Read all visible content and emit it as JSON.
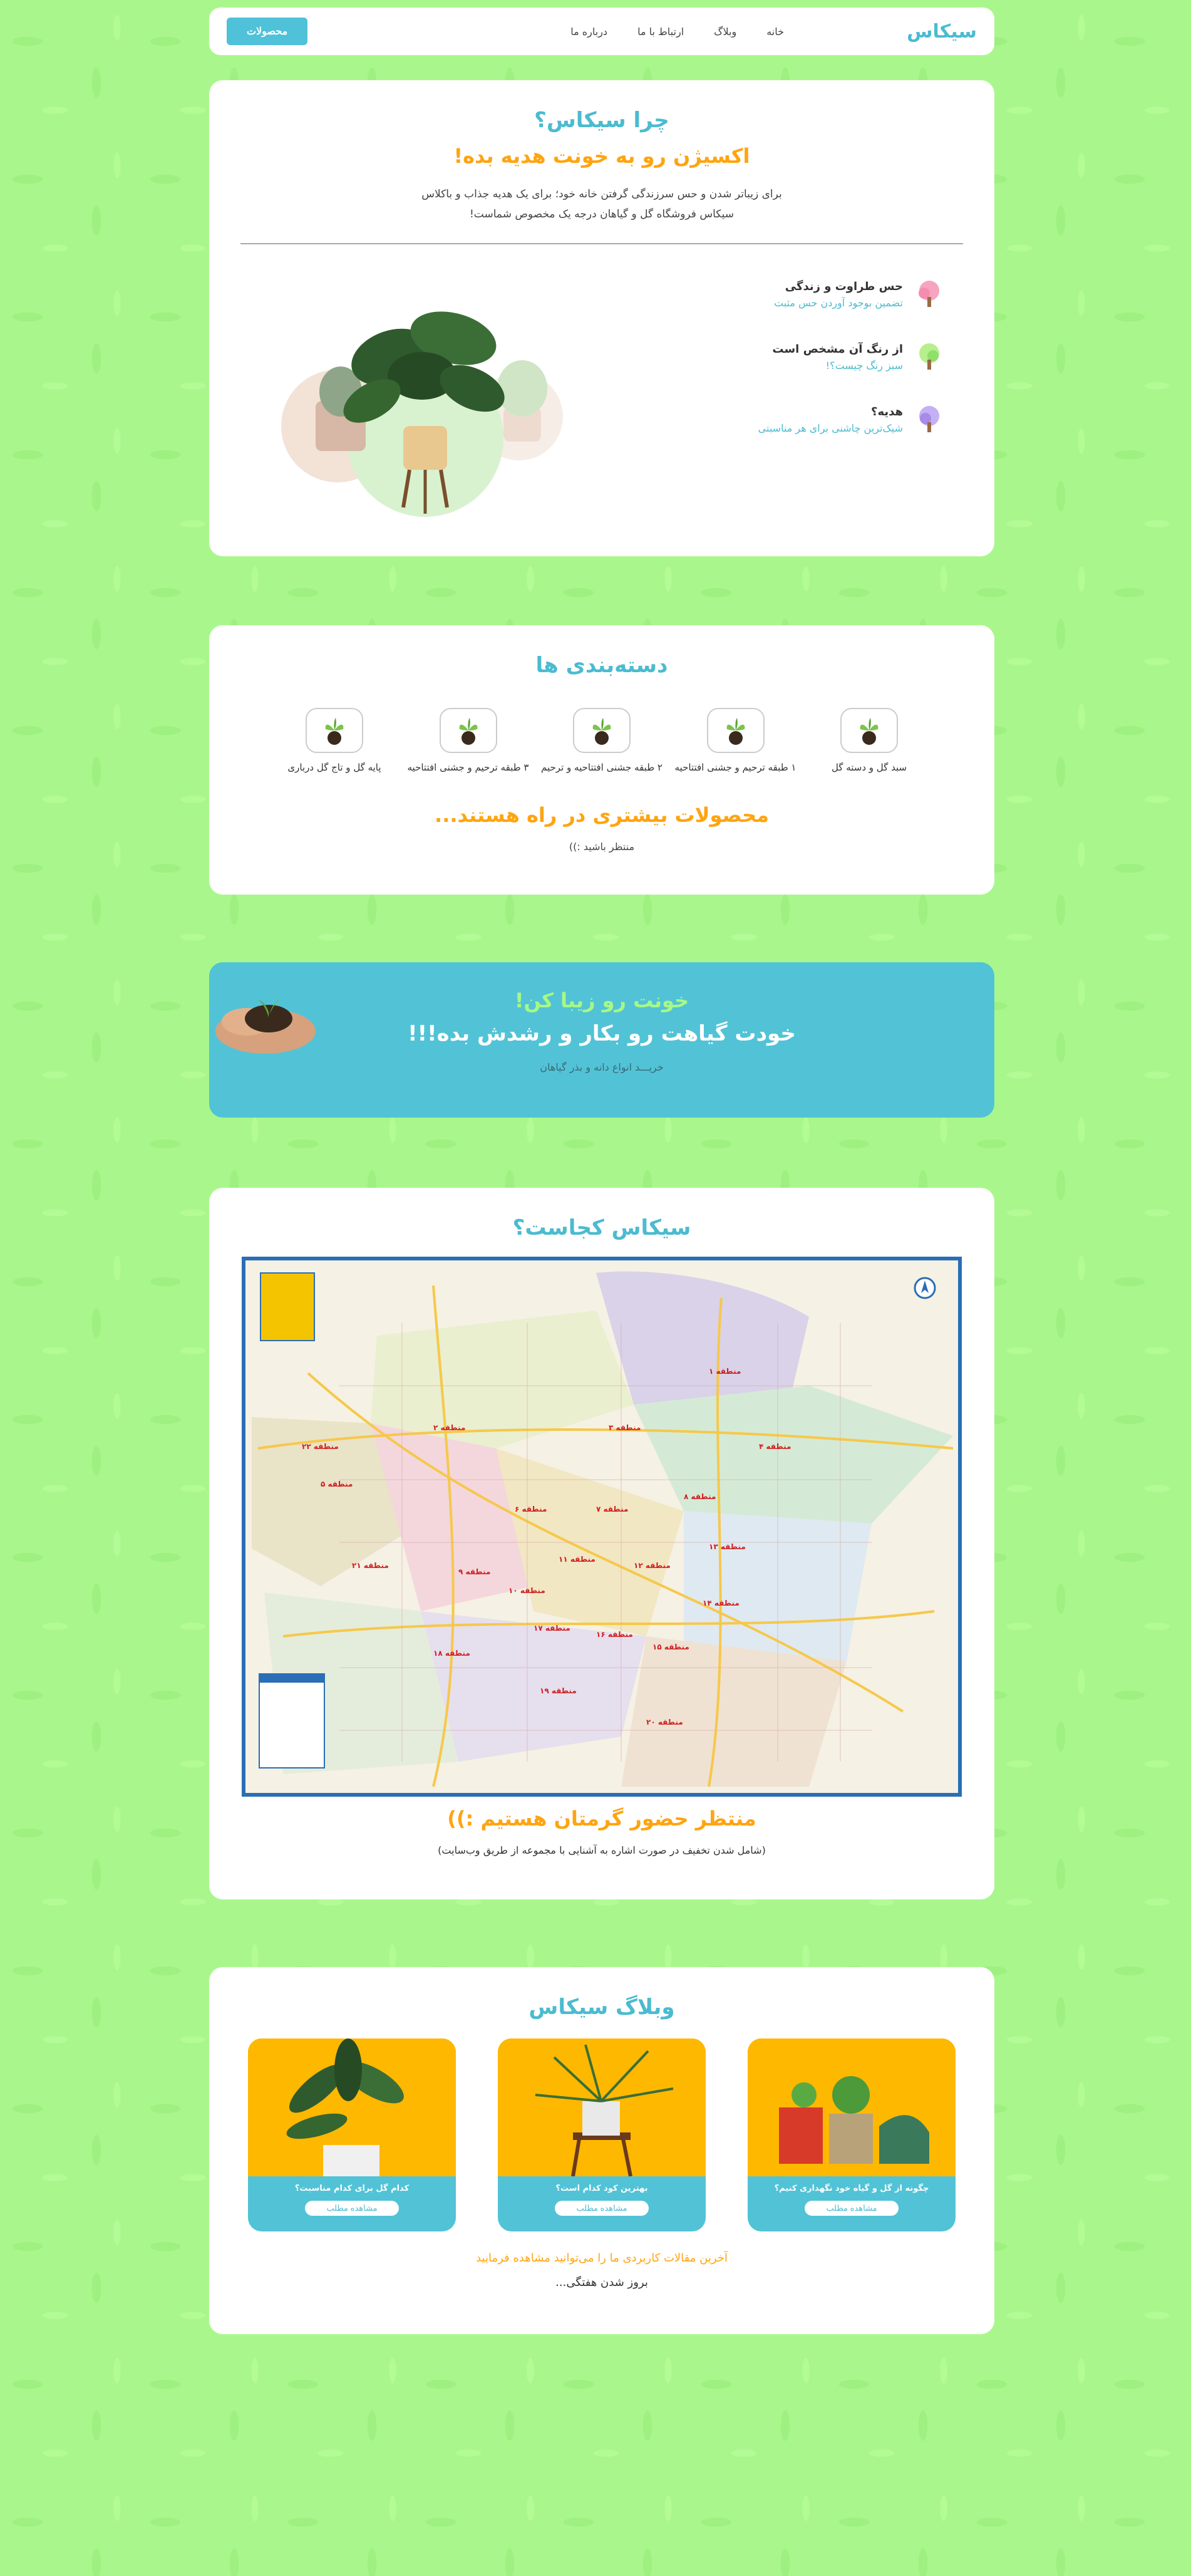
{
  "nav": {
    "brand": "سیکاس",
    "links": [
      "خانه",
      "وبلاگ",
      "ارتباط با ما",
      "درباره ما"
    ],
    "products_button": "محصولات"
  },
  "why": {
    "title": "چرا سیکاس؟",
    "subtitle": "اکسیژن رو به خونت هدیه بده!",
    "desc_line1": "برای زیباتر شدن و حس سرزندگی گرفتن خانه خود؛ برای یک هدیه جذاب و باکلاس",
    "desc_line2": "سیکاس فروشگاه گل و گیاهان درجه یک مخصوص شماست!",
    "features": [
      {
        "title": "حس طراوت و زندگی",
        "sub": "تضمین بوجود آوردن حس مثبت",
        "icon": "pink-tree-icon",
        "color": "#f6a4c0"
      },
      {
        "title": "از رنگ آن مشخص است",
        "sub": "سبز رنگ چیست؟!",
        "icon": "green-tree-icon",
        "color": "#8fe06a"
      },
      {
        "title": "هدیه؟",
        "sub": "شیک‌ترین چاشنی برای هر مناسبتی",
        "icon": "purple-tree-icon",
        "color": "#b69cf0"
      }
    ]
  },
  "categories": {
    "title": "دسته‌بندی ها",
    "items": [
      {
        "label": "سبد گل و دسته گل"
      },
      {
        "label": "۱ طبقه ترحیم و جشنی افتتاحیه"
      },
      {
        "label": "۲ طبقه جشنی افتتاحیه و ترحیم"
      },
      {
        "label": "۳ طبقه ترحیم و جشنی افتتاحیه"
      },
      {
        "label": "پایه گل و تاج گل درباری"
      }
    ],
    "more": "محصولات بیشتری در راه هستند...",
    "wait": "منتظر باشید :))"
  },
  "banner": {
    "line1": "خونت رو زیبا کن!",
    "line2": "خودت گیاهت رو بکار و رشدش بده!!!",
    "line3": "خریـــد انواع دانه و بذر گیاهان"
  },
  "location": {
    "title": "سیکاس کجاست؟",
    "wait": "منتظر حضور گرمتان هستیم :))",
    "note": "(شامل شدن تخفیف در صورت اشاره به آشنایی با مجموعه از طریق وب‌سایت)",
    "districts": [
      "منطقه ۱",
      "منطقه ۲",
      "منطقه ۳",
      "منطقه ۴",
      "منطقه ۵",
      "منطقه ۶",
      "منطقه ۷",
      "منطقه ۸",
      "منطقه ۹",
      "منطقه ۱۰",
      "منطقه ۱۱",
      "منطقه ۱۲",
      "منطقه ۱۳",
      "منطقه ۱۴",
      "منطقه ۱۵",
      "منطقه ۱۶",
      "منطقه ۱۷",
      "منطقه ۱۸",
      "منطقه ۱۹",
      "منطقه ۲۰",
      "منطقه ۲۱",
      "منطقه ۲۲"
    ]
  },
  "blog": {
    "title": "وبلاگ سیکاس",
    "posts": [
      {
        "title": "چگونه از گل و گیاه خود نگهداری کنیم؟",
        "button": "مشاهده مطلب"
      },
      {
        "title": "بهترین کود کدام است؟",
        "button": "مشاهده مطلب"
      },
      {
        "title": "کدام گل برای کدام مناسبت؟",
        "button": "مشاهده مطلب"
      }
    ],
    "latest": "آخرین مقالات کاربردی ما را می‌توانید مشاهده فرمایید",
    "update": "بروز شدن هفتگی..."
  }
}
